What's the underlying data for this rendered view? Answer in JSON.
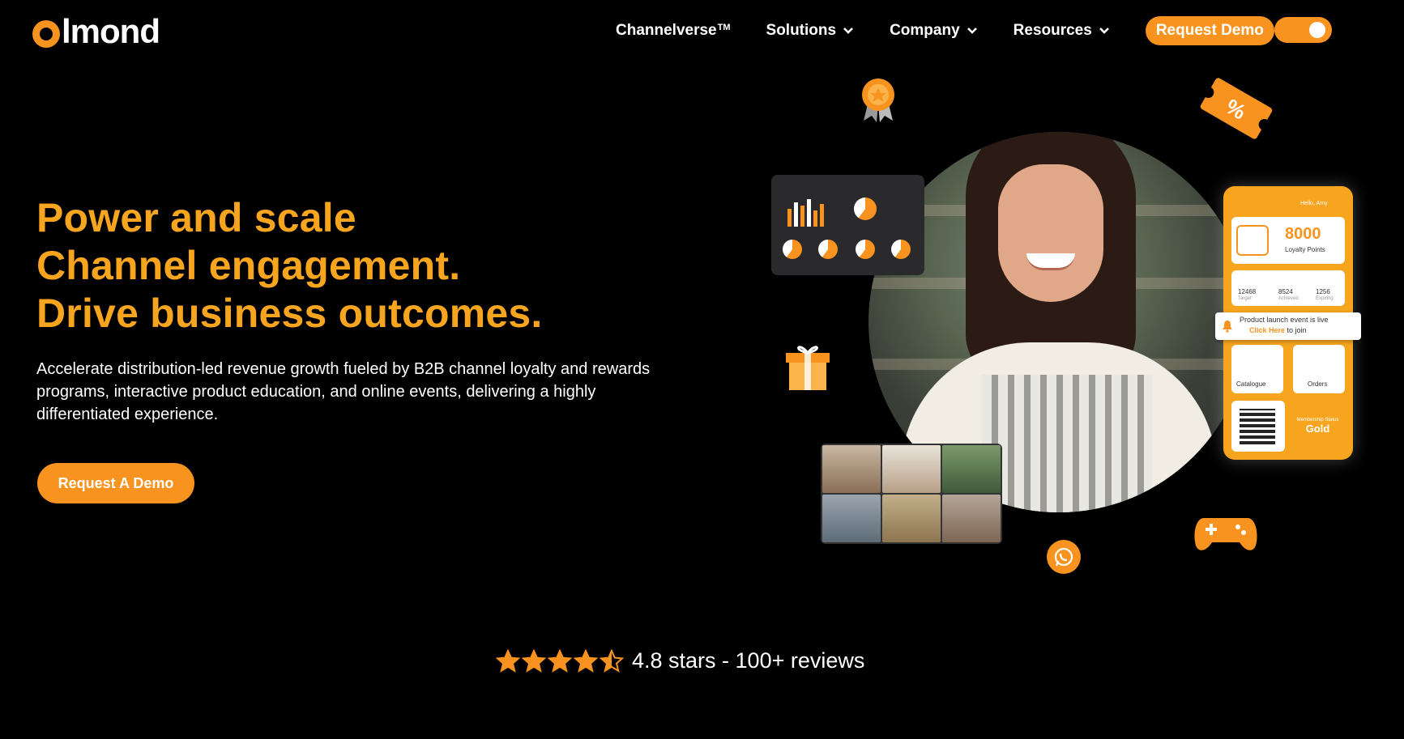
{
  "brand": {
    "logo_text": "lmond"
  },
  "nav": {
    "items": [
      {
        "label": "Channelverse",
        "sup": "TM"
      },
      {
        "label": "Solutions"
      },
      {
        "label": "Company"
      },
      {
        "label": "Resources"
      }
    ],
    "cta_label": "Request Demo",
    "theme_toggle_on": true
  },
  "hero": {
    "headline": [
      "Power and scale",
      "Channel engagement.",
      "Drive business outcomes."
    ],
    "subtext": "Accelerate distribution-led revenue growth fueled by B2B channel loyalty and rewards programs, interactive product education, and online events, delivering a highly differentiated experience.",
    "cta_label": "Request A Demo"
  },
  "illustration": {
    "phone": {
      "greeting": "Hello, Amy",
      "points_value": "8000",
      "points_label": "Loyalty Points",
      "stats": [
        {
          "value": "12468",
          "label": "Target"
        },
        {
          "value": "8524",
          "label": "Achieved"
        },
        {
          "value": "1256",
          "label": "Expiring"
        }
      ],
      "catalogue_label": "Catalogue",
      "orders_label": "Orders",
      "membership_label": "Membership Status",
      "membership_value": "Gold"
    },
    "notification": {
      "line1": "Product launch event is live",
      "link": "Click Here",
      "line2_suffix": "to join"
    }
  },
  "rating": {
    "stars": 4.5,
    "text": "4.8 stars - 100+ reviews"
  },
  "colors": {
    "accent": "#f7931e",
    "headline": "#f7a51e",
    "background": "#000000"
  }
}
